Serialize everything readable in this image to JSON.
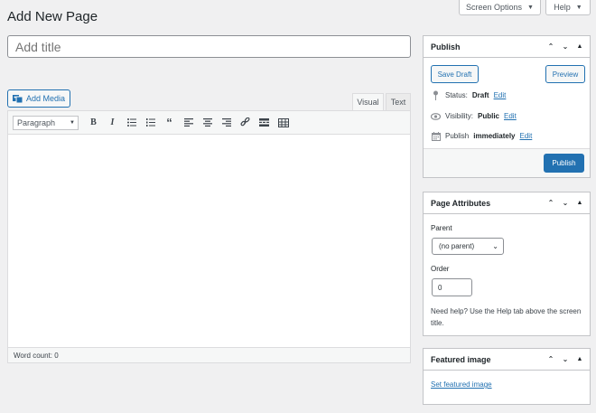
{
  "header": {
    "title": "Add New Page",
    "screen_options_label": "Screen Options",
    "help_label": "Help"
  },
  "editor": {
    "title_placeholder": "Add title",
    "add_media_label": "Add Media",
    "tab_visual": "Visual",
    "tab_text": "Text",
    "format_select": "Paragraph",
    "toolbar_icons": [
      "bold-icon",
      "italic-icon",
      "bulleted-list-icon",
      "numbered-list-icon",
      "blockquote-icon",
      "align-left-icon",
      "align-center-icon",
      "align-right-icon",
      "insert-link-icon",
      "read-more-icon",
      "toolbar-toggle-icon"
    ],
    "word_count": "Word count: 0"
  },
  "publish_box": {
    "title": "Publish",
    "save_draft_label": "Save Draft",
    "preview_label": "Preview",
    "status_label": "Status:",
    "status_value": "Draft",
    "visibility_label": "Visibility:",
    "visibility_value": "Public",
    "publish_label": "Publish",
    "publish_value": "immediately",
    "edit_label": "Edit",
    "publish_button_label": "Publish"
  },
  "page_attributes": {
    "title": "Page Attributes",
    "parent_label": "Parent",
    "parent_value": "(no parent)",
    "order_label": "Order",
    "order_value": "0",
    "help_text": "Need help? Use the Help tab above the screen title."
  },
  "featured_image": {
    "title": "Featured image",
    "link_label": "Set featured image"
  },
  "colors": {
    "accent": "#2271b1",
    "background": "#f0f0f1",
    "border": "#c3c4c7"
  }
}
